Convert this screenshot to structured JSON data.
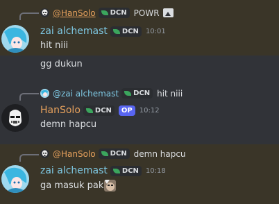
{
  "messages": [
    {
      "reply": {
        "name": "@HanSolo",
        "tag": "DCN",
        "text": "POWR"
      },
      "author": "zai alchemast",
      "tag": "DCN",
      "time": "10:01",
      "lines": [
        "hit niii",
        "gg dukun"
      ]
    },
    {
      "reply": {
        "name": "@zai alchemast",
        "tag": "DCN",
        "text": "hit niii"
      },
      "author": "HanSolo",
      "tag": "DCN",
      "badge": "OP",
      "time": "10:12",
      "lines": [
        "demn hapcu"
      ]
    },
    {
      "reply": {
        "name": "@HanSolo",
        "tag": "DCN",
        "text": "demn hapcu"
      },
      "author": "zai alchemast",
      "tag": "DCN",
      "time": "10:18",
      "lines": [
        "ga masuk pak"
      ]
    }
  ],
  "colors": {
    "highlight": "#3a3528",
    "background": "#313338",
    "zai": "#7ec8e3",
    "hansolo": "#e5a05c",
    "op": "#5865f2"
  }
}
